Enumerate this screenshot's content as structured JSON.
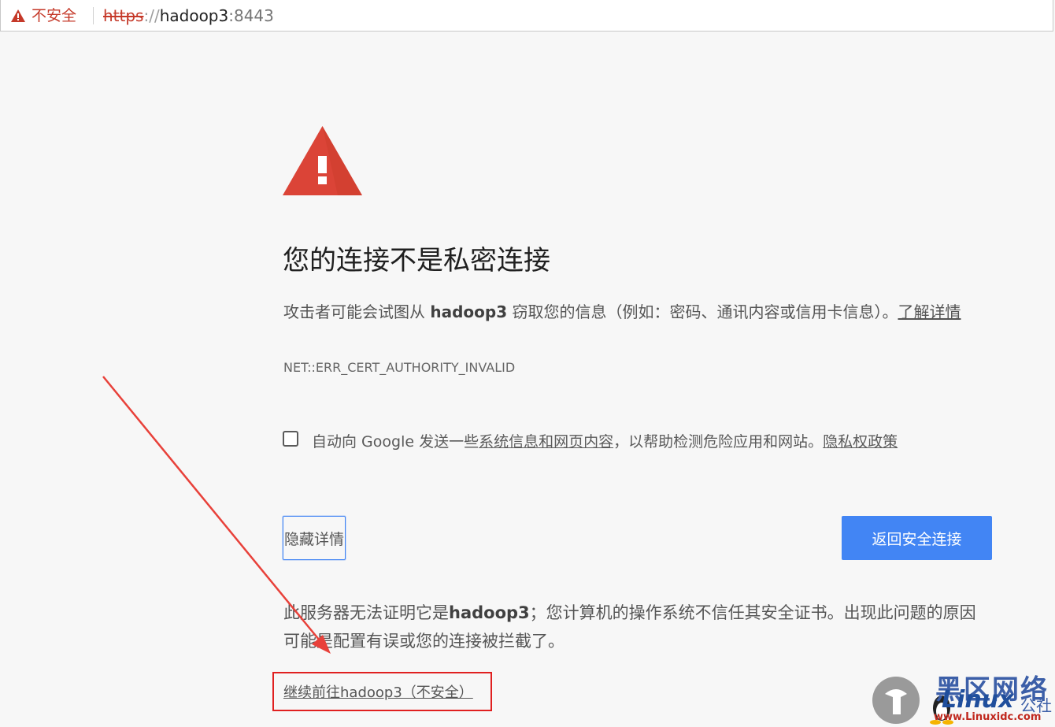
{
  "address_bar": {
    "security_label": "不安全",
    "url_scheme": "https",
    "url_separator": "://",
    "url_host": "hadoop3",
    "url_port": ":8443"
  },
  "interstitial": {
    "headline": "您的连接不是私密连接",
    "explanation_prefix": "攻击者可能会试图从 ",
    "explanation_host": "hadoop3",
    "explanation_suffix": " 窃取您的信息（例如：密码、通讯内容或信用卡信息）。",
    "learn_more": "了解详情",
    "error_code": "NET::ERR_CERT_AUTHORITY_INVALID",
    "report": {
      "prefix": "自动向 Google 发送一些",
      "link": "系统信息和网页内容",
      "middle": "，以帮助检测危险应用和网站。",
      "privacy_link": "隐私权政策"
    },
    "hide_details_label": "隐藏详情",
    "back_to_safety_label": "返回安全连接",
    "details_prefix": "此服务器无法证明它是",
    "details_host": "hadoop3",
    "details_suffix": "；您计算机的操作系统不信任其安全证书。出现此问题的原因可能是配置有误或您的连接被拦截了。",
    "proceed_link": "继续前往hadoop3（不安全）"
  },
  "watermark": {
    "chinese": "黑区网络",
    "brand": "Linux",
    "suffix": "公社",
    "url": "www.Linuxidc.com"
  },
  "colors": {
    "warning_red": "#db4437",
    "insecure_red": "#c53929",
    "primary_blue": "#4285f4",
    "annotation_red": "#e02020"
  }
}
